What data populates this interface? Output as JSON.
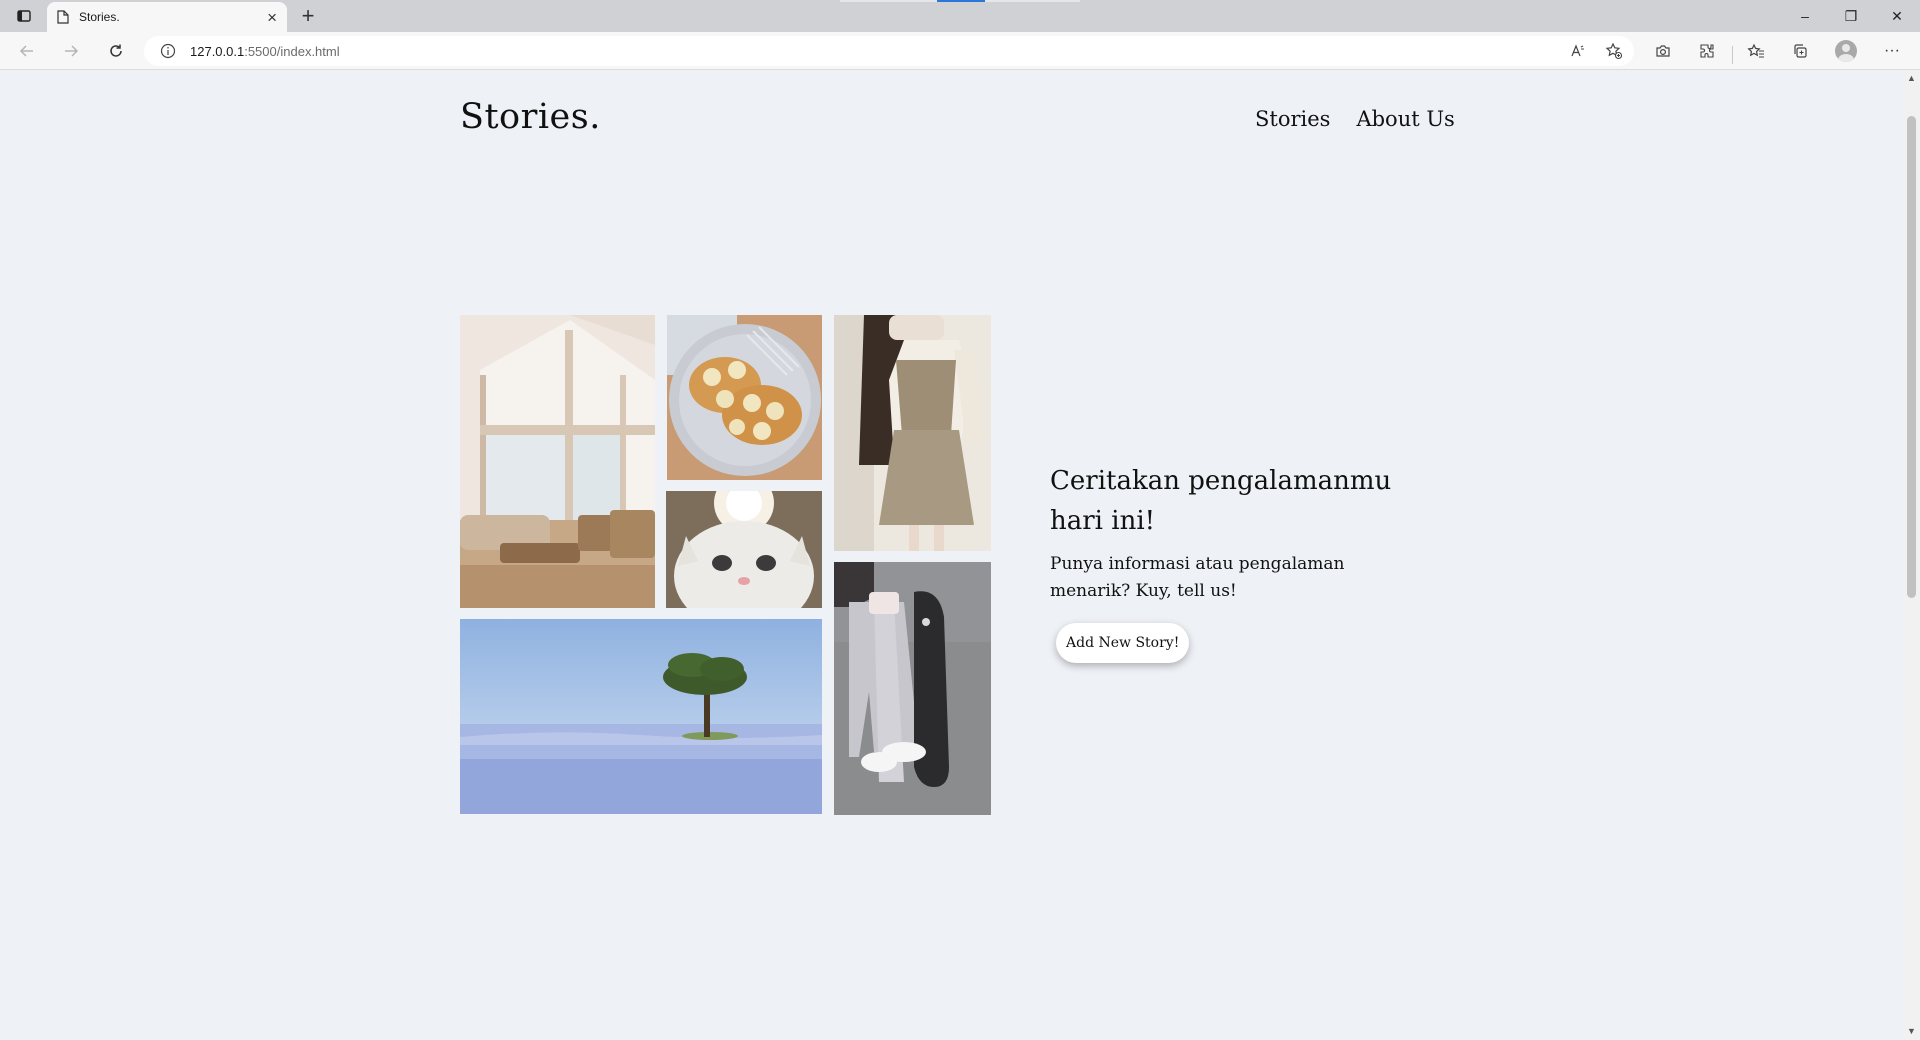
{
  "browser": {
    "tab_title": "Stories.",
    "url_host": "127.0.0.1",
    "url_rest": ":5500/index.html",
    "new_tab_symbol": "+",
    "icons": [
      "sidebar-icon",
      "page-icon",
      "close-icon",
      "back-icon",
      "forward-icon",
      "refresh-icon",
      "info-icon",
      "read-aloud-icon",
      "favorite-add-icon",
      "screenshot-icon",
      "extensions-icon",
      "favorites-icon",
      "collections-icon",
      "profile-icon",
      "more-icon"
    ],
    "window_controls": {
      "minimize": "–",
      "restore": "❐",
      "close": "✕"
    }
  },
  "site": {
    "brand": "Stories.",
    "nav": [
      {
        "label": "Stories"
      },
      {
        "label": "About Us"
      }
    ]
  },
  "gallery": {
    "photos": [
      "living-room",
      "banana-pancakes",
      "fashion-outfit",
      "white-cat",
      "flower-field-tree",
      "skateboard-legs"
    ]
  },
  "hero": {
    "heading": "Ceritakan pengalamanmu hari ini!",
    "text": "Punya informasi atau pengalaman menarik? Kuy, tell us!",
    "button": "Add New Story!"
  },
  "colors": {
    "page_background": "#eef1f6",
    "chrome_tabbar": "#cfd1d4",
    "chrome_toolbar": "#f7f7f7"
  }
}
